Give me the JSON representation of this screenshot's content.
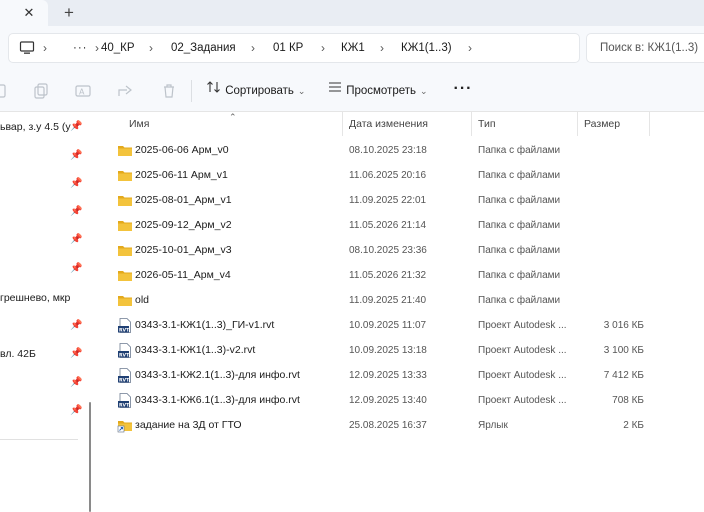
{
  "window": {
    "tab_close_glyph": "✕",
    "tab_new_glyph": "+"
  },
  "address_bar": {
    "more_glyph": "···",
    "crumbs": [
      "40_КР",
      "02_Задания",
      "01 КР",
      "КЖ1",
      "КЖ1(1..3)"
    ],
    "search_placeholder": "Поиск в: КЖ1(1..3)"
  },
  "toolbar": {
    "sort_label": "Сортировать",
    "view_label": "Просмотреть",
    "more_glyph": "···"
  },
  "sidebar": {
    "items": [
      {
        "label": "ьвар, з.у 4.5 (у"
      },
      {
        "label": ""
      },
      {
        "label": ""
      },
      {
        "label": ""
      },
      {
        "label": ""
      },
      {
        "label": ""
      },
      {
        "label": "грешнево, мкр"
      },
      {
        "label": ""
      },
      {
        "label": "вл. 42Б"
      },
      {
        "label": ""
      },
      {
        "label": ""
      }
    ]
  },
  "columns": {
    "name": "Имя",
    "date": "Дата изменения",
    "type": "Тип",
    "size": "Размер"
  },
  "files": [
    {
      "name": "2025-06-06 Арм_v0",
      "date": "08.10.2025 23:18",
      "type": "Папка с файлами",
      "size": "",
      "icon": "folder"
    },
    {
      "name": "2025-06-11 Арм_v1",
      "date": "11.06.2025 20:16",
      "type": "Папка с файлами",
      "size": "",
      "icon": "folder"
    },
    {
      "name": "2025-08-01_Арм_v1",
      "date": "11.09.2025 22:01",
      "type": "Папка с файлами",
      "size": "",
      "icon": "folder"
    },
    {
      "name": "2025-09-12_Арм_v2",
      "date": "11.05.2026 21:14",
      "type": "Папка с файлами",
      "size": "",
      "icon": "folder"
    },
    {
      "name": "2025-10-01_Арм_v3",
      "date": "08.10.2025 23:36",
      "type": "Папка с файлами",
      "size": "",
      "icon": "folder"
    },
    {
      "name": "2026-05-11_Арм_v4",
      "date": "11.05.2026 21:32",
      "type": "Папка с файлами",
      "size": "",
      "icon": "folder"
    },
    {
      "name": "old",
      "date": "11.09.2025 21:40",
      "type": "Папка с файлами",
      "size": "",
      "icon": "folder"
    },
    {
      "name": "0343-3.1-КЖ1(1..3)_ГИ-v1.rvt",
      "date": "10.09.2025 11:07",
      "type": "Проект Autodesk ...",
      "size": "3 016 КБ",
      "icon": "rvt"
    },
    {
      "name": "0343-3.1-КЖ1(1..3)-v2.rvt",
      "date": "10.09.2025 13:18",
      "type": "Проект Autodesk ...",
      "size": "3 100 КБ",
      "icon": "rvt"
    },
    {
      "name": "0343-3.1-КЖ2.1(1..3)-для инфо.rvt",
      "date": "12.09.2025 13:33",
      "type": "Проект Autodesk ...",
      "size": "7 412 КБ",
      "icon": "rvt"
    },
    {
      "name": "0343-3.1-КЖ6.1(1..3)-для инфо.rvt",
      "date": "12.09.2025 13:40",
      "type": "Проект Autodesk ...",
      "size": "708 КБ",
      "icon": "rvt"
    },
    {
      "name": "задание на 3Д от ГТО",
      "date": "25.08.2025 16:37",
      "type": "Ярлык",
      "size": "2 КБ",
      "icon": "shortcut"
    }
  ],
  "colors": {
    "folder": "#f3c33c",
    "folder_dark": "#e3a91c",
    "rvt": "#1f3f73",
    "chrome": "#f7f9fc"
  }
}
